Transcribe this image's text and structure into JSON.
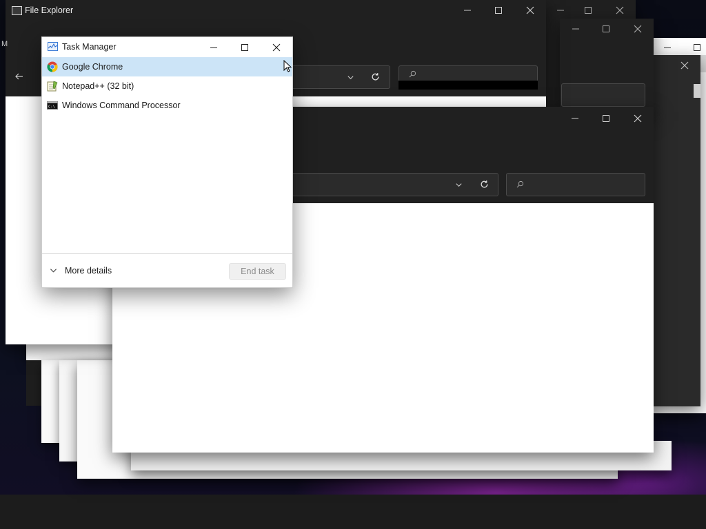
{
  "background_windows": {
    "file_explorer_title": "File Explorer",
    "partial_left_letter": "M"
  },
  "task_manager": {
    "title": "Task Manager",
    "processes": [
      {
        "name": "Google Chrome",
        "icon": "chrome-icon",
        "selected": true
      },
      {
        "name": "Notepad++ (32 bit)",
        "icon": "notepadpp-icon",
        "selected": false
      },
      {
        "name": "Windows Command Processor",
        "icon": "cmd-icon",
        "selected": false
      }
    ],
    "more_details_label": "More details",
    "end_task_label": "End task"
  },
  "colors": {
    "titlebar_dark": "#202020",
    "selection": "#cce4f7",
    "accent_purple": "#9628aa"
  }
}
